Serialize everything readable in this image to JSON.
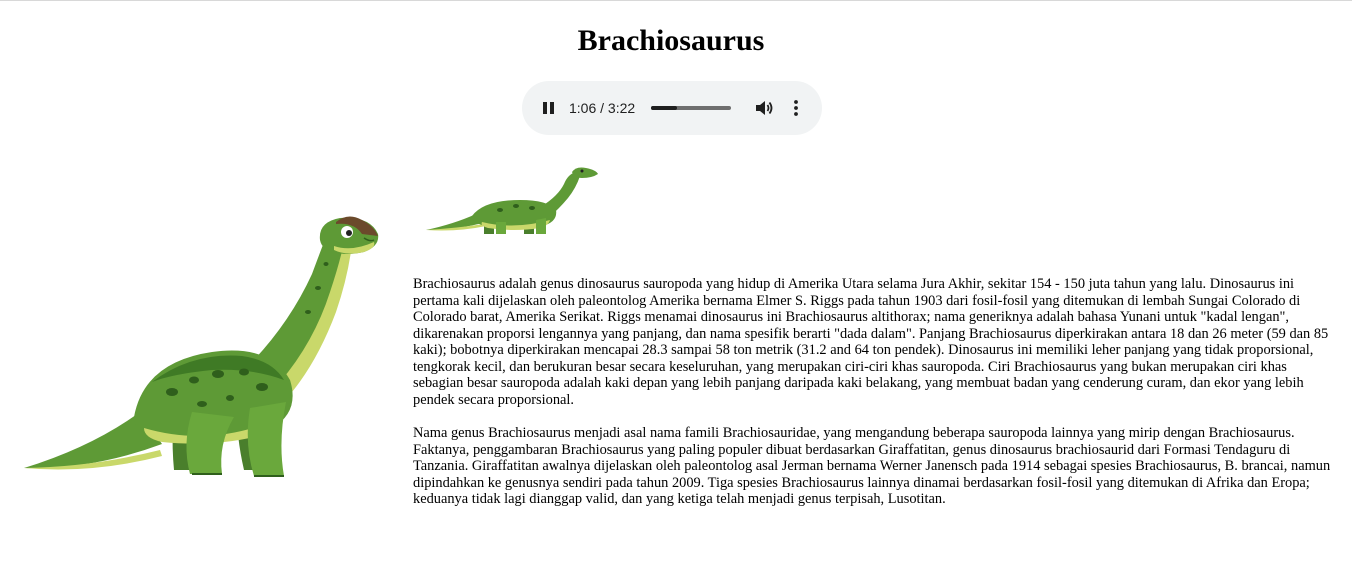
{
  "page": {
    "title": "Brachiosaurus"
  },
  "audio": {
    "state": "playing",
    "current_time": "1:06",
    "duration": "3:22",
    "time_text": "1:06 / 3:22",
    "progress_fraction": 0.33
  },
  "images": [
    {
      "name": "brachiosaurus-cartoon-standing"
    },
    {
      "name": "brachiosaurus-cartoon-walking"
    }
  ],
  "article": {
    "paragraphs": [
      "Brachiosaurus adalah genus dinosaurus sauropoda yang hidup di Amerika Utara selama Jura Akhir, sekitar 154 - 150 juta tahun yang lalu. Dinosaurus ini pertama kali dijelaskan oleh paleontolog Amerika bernama Elmer S. Riggs pada tahun 1903 dari fosil-fosil yang ditemukan di lembah Sungai Colorado di Colorado barat, Amerika Serikat. Riggs menamai dinosaurus ini Brachiosaurus altithorax; nama generiknya adalah bahasa Yunani untuk \"kadal lengan\", dikarenakan proporsi lengannya yang panjang, dan nama spesifik berarti \"dada dalam\". Panjang Brachiosaurus diperkirakan antara 18 dan 26 meter (59 dan 85 kaki); bobotnya diperkirakan mencapai 28.3 sampai 58 ton metrik (31.2 and 64 ton pendek). Dinosaurus ini memiliki leher panjang yang tidak proporsional, tengkorak kecil, dan berukuran besar secara keseluruhan, yang merupakan ciri-ciri khas sauropoda. Ciri Brachiosaurus yang bukan merupakan ciri khas sebagian besar sauropoda adalah kaki depan yang lebih panjang daripada kaki belakang, yang membuat badan yang cenderung curam, dan ekor yang lebih pendek secara proporsional.",
      "Nama genus Brachiosaurus menjadi asal nama famili Brachiosauridae, yang mengandung beberapa sauropoda lainnya yang mirip dengan Brachiosaurus. Faktanya, penggambaran Brachiosaurus yang paling populer dibuat berdasarkan Giraffatitan, genus dinosaurus brachiosaurid dari Formasi Tendaguru di Tanzania. Giraffatitan awalnya dijelaskan oleh paleontolog asal Jerman bernama Werner Janensch pada 1914 sebagai spesies Brachiosaurus, B. brancai, namun dipindahkan ke genusnya sendiri pada tahun 2009. Tiga spesies Brachiosaurus lainnya dinamai berdasarkan fosil-fosil yang ditemukan di Afrika dan Eropa; keduanya tidak lagi dianggap valid, dan yang ketiga telah menjadi genus terpisah, Lusotitan."
    ]
  },
  "colors": {
    "player_bg": "#f1f3f4",
    "dino_body": "#5e9a36",
    "dino_dark": "#3f7a25",
    "dino_belly": "#c9d86a",
    "dino_spots": "#2f5f1c"
  },
  "icons": {
    "pause": "pause-icon",
    "volume": "volume-icon",
    "menu": "more-vertical-icon"
  }
}
